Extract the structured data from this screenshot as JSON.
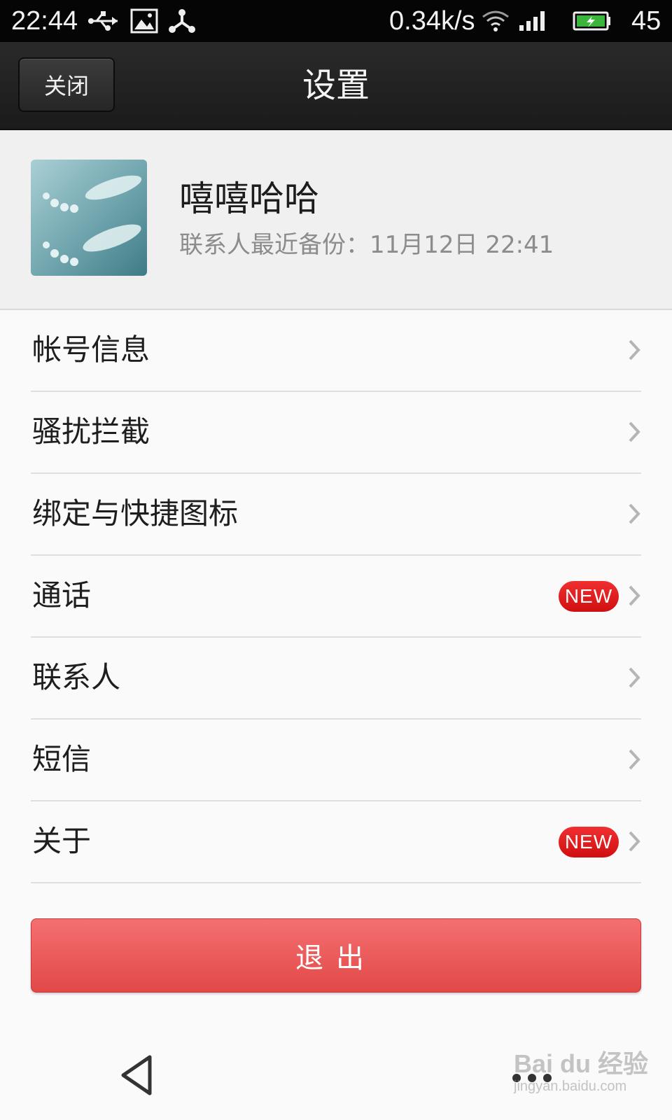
{
  "status_bar": {
    "time": "22:44",
    "net_speed": "0.34k/s",
    "battery": "45"
  },
  "header": {
    "close_label": "关闭",
    "title": "设置"
  },
  "profile": {
    "name": "嘻嘻哈哈",
    "backup_text": "联系人最近备份：11月12日 22:41"
  },
  "menu": {
    "items": [
      {
        "label": "帐号信息",
        "badge": ""
      },
      {
        "label": "骚扰拦截",
        "badge": ""
      },
      {
        "label": "绑定与快捷图标",
        "badge": ""
      },
      {
        "label": "通话",
        "badge": "NEW"
      },
      {
        "label": "联系人",
        "badge": ""
      },
      {
        "label": "短信",
        "badge": ""
      },
      {
        "label": "关于",
        "badge": "NEW"
      }
    ]
  },
  "logout_label": "退出",
  "watermark": {
    "main": "Bai du 经验",
    "sub": "jingyan.baidu.com"
  },
  "colors": {
    "accent_red": "#e24848",
    "badge_red": "#e02020",
    "header_dark": "#222222"
  },
  "icons": [
    "usb-icon",
    "image-icon",
    "share-icon",
    "wifi-icon",
    "signal-icon",
    "battery-icon",
    "chevron-right-icon",
    "back-icon",
    "more-icon"
  ]
}
